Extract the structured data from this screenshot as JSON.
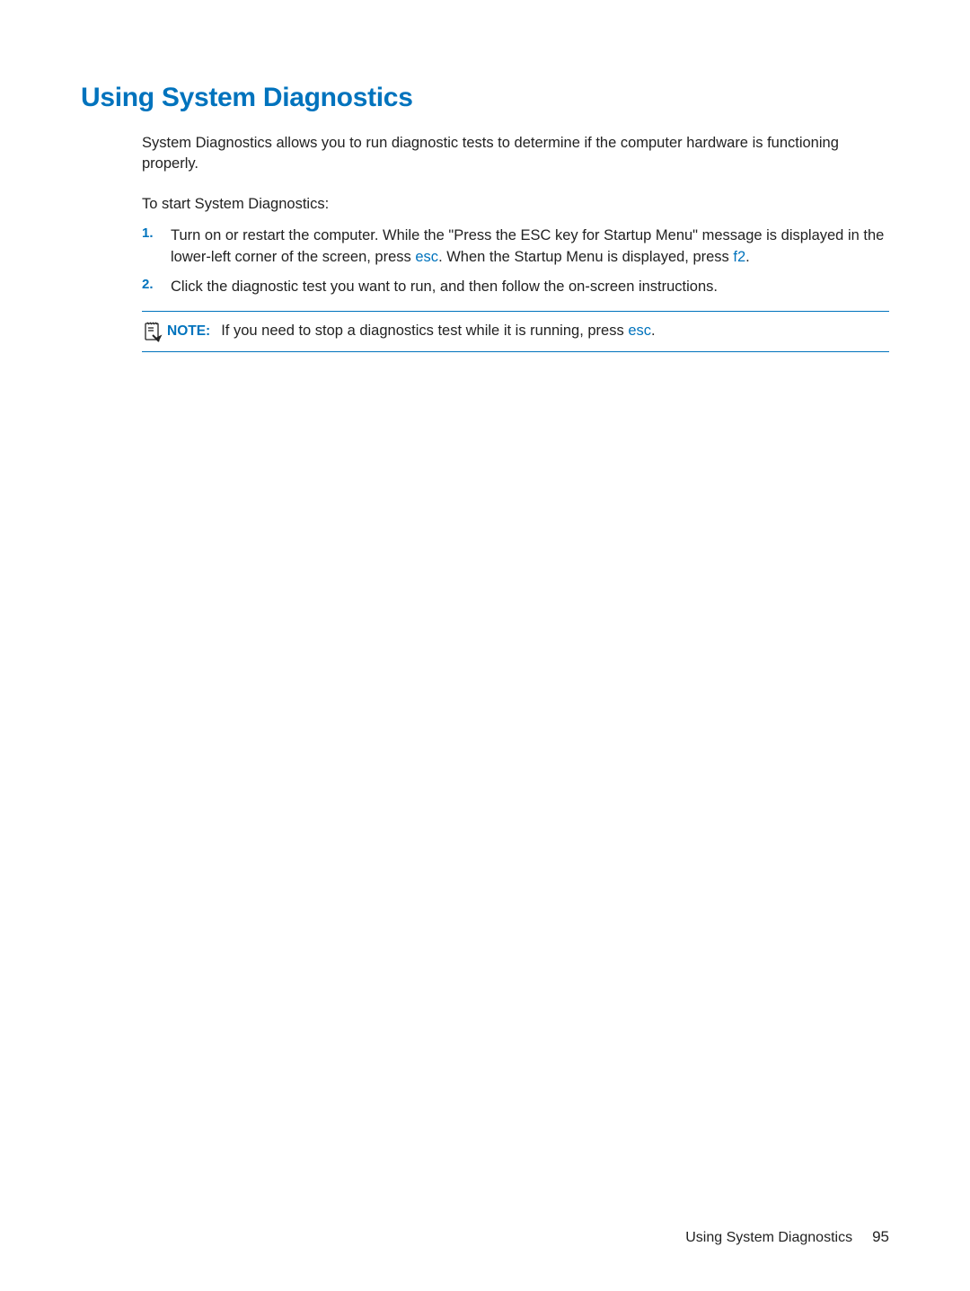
{
  "heading": "Using System Diagnostics",
  "intro": "System Diagnostics allows you to run diagnostic tests to determine if the computer hardware is functioning properly.",
  "startText": "To start System Diagnostics:",
  "steps": {
    "one": {
      "number": "1.",
      "part1": "Turn on or restart the computer. While the \"Press the ESC key for Startup Menu\" message is displayed in the lower-left corner of the screen, press ",
      "key1": "esc",
      "part2": ". When the Startup Menu is displayed, press ",
      "key2": "f2",
      "part3": "."
    },
    "two": {
      "number": "2.",
      "text": "Click the diagnostic test you want to run, and then follow the on-screen instructions."
    }
  },
  "note": {
    "label": "NOTE:",
    "part1": "If you need to stop a diagnostics test while it is running, press ",
    "key": "esc",
    "part2": "."
  },
  "footer": {
    "title": "Using System Diagnostics",
    "pageNumber": "95"
  }
}
